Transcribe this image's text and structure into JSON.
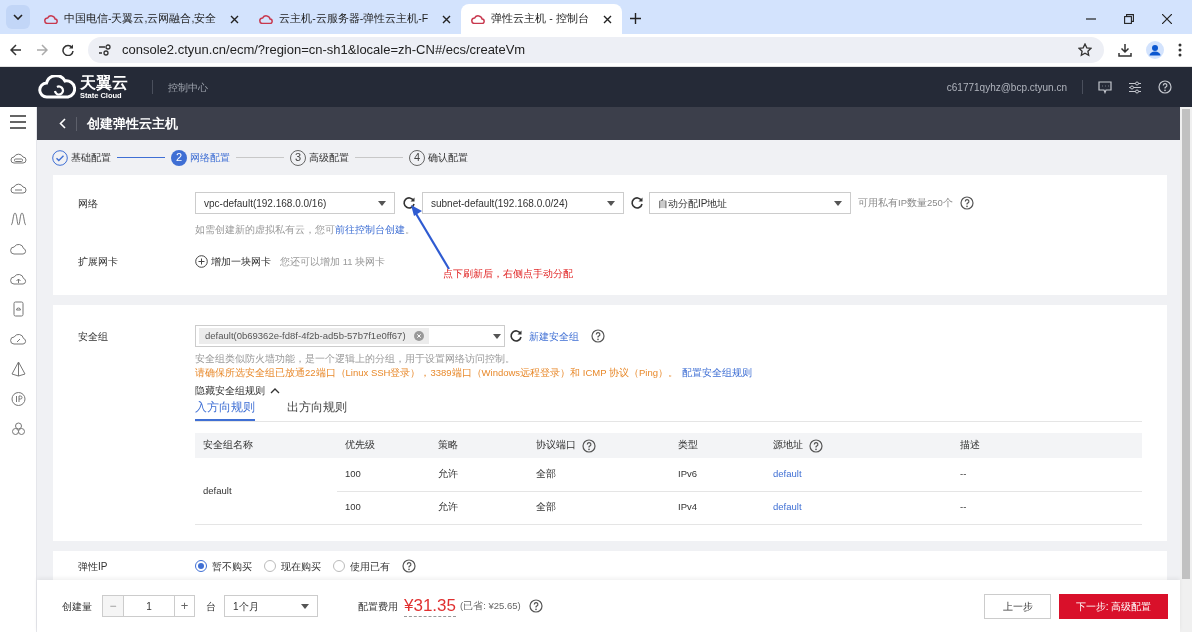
{
  "browser": {
    "tabs": [
      {
        "title": "中国电信-天翼云,云网融合,安全",
        "selected": false
      },
      {
        "title": "云主机-云服务器-弹性云主机-F",
        "selected": false
      },
      {
        "title": "弹性云主机 - 控制台",
        "selected": true
      }
    ],
    "url": "console2.ctyun.cn/ecm/?region=cn-sh1&locale=zh-CN#/ecs/createVm"
  },
  "header": {
    "logo_name": "天翼云",
    "logo_sub": "State Cloud",
    "nav": "控制中心",
    "user": "c61771qyhz@bcp.ctyun.cn"
  },
  "page_title": "创建弹性云主机",
  "steps": [
    {
      "label": "基础配置",
      "completed": true,
      "current": false
    },
    {
      "number": "2",
      "label": "网络配置",
      "completed": false,
      "current": true
    },
    {
      "number": "3",
      "label": "高级配置",
      "completed": false,
      "current": false
    },
    {
      "number": "4",
      "label": "确认配置",
      "completed": false,
      "current": false
    }
  ],
  "network": {
    "label": "网络",
    "vpc": "vpc-default(192.168.0.0/16)",
    "subnet": "subnet-default(192.168.0.0/24)",
    "ip_mode": "自动分配IP地址",
    "ip_note": "可用私有IP数量250个",
    "hint": "如需创建新的虚拟私有云，您可",
    "hint_link": "前往控制台创建",
    "hint_end": "。"
  },
  "extra_nic": {
    "label": "扩展网卡",
    "add": "增加一块网卡",
    "note": "您还可以增加 11 块网卡"
  },
  "annotation": "点下刷新后，右侧点手动分配",
  "security": {
    "label": "安全组",
    "tag": "default(0b69362e-fd8f-4f2b-ad5b-57b7f1e0ff67)",
    "create_link": "新建安全组",
    "desc": "安全组类似防火墙功能，是一个逻辑上的分组，用于设置网络访问控制。",
    "warning": "请确保所选安全组已放通22端口（Linux SSH登录），3389端口（Windows远程登录）和 ICMP 协议（Ping）。",
    "warning_link": "配置安全组规则",
    "toggle": "隐藏安全组规则",
    "expanded": true,
    "rule_tabs": [
      {
        "label": "入方向规则",
        "selected": true
      },
      {
        "label": "出方向规则",
        "selected": false
      }
    ],
    "columns": [
      {
        "label": "安全组名称",
        "help": false
      },
      {
        "label": "优先级",
        "help": false
      },
      {
        "label": "策略",
        "help": false
      },
      {
        "label": "协议端口",
        "help": true
      },
      {
        "label": "类型",
        "help": false
      },
      {
        "label": "源地址",
        "help": true
      },
      {
        "label": "描述",
        "help": false
      }
    ],
    "groups": [
      {
        "name": "default",
        "rules": [
          {
            "priority": "100",
            "action": "允许",
            "ports": "全部",
            "type": "IPv6",
            "source": "default",
            "description": "--"
          },
          {
            "priority": "100",
            "action": "允许",
            "ports": "全部",
            "type": "IPv4",
            "source": "default",
            "description": "--"
          }
        ]
      }
    ]
  },
  "eip": {
    "label": "弹性IP",
    "options": [
      {
        "label": "暂不购买",
        "selected": true
      },
      {
        "label": "现在购买",
        "selected": false
      },
      {
        "label": "使用已有",
        "selected": false
      }
    ]
  },
  "footer": {
    "qty_label": "创建量",
    "minus": "−",
    "qty": "1",
    "plus": "+",
    "unit": "台",
    "duration": "1个月",
    "price_label": "配置费用",
    "price": "¥31.35",
    "saved": "(已省: ¥25.65)",
    "prev": "上一步",
    "next": "下一步: 高级配置"
  }
}
